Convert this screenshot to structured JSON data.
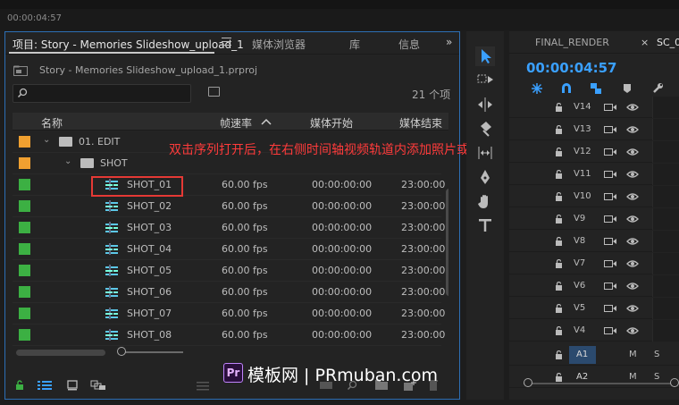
{
  "top": {
    "timecode": "00:00:04:57"
  },
  "project": {
    "tabs": [
      {
        "label": "项目: Story - Memories Slideshow_upload_1"
      },
      {
        "label": "媒体浏览器"
      },
      {
        "label": "库"
      },
      {
        "label": "信息"
      }
    ],
    "more": "»",
    "path": "Story - Memories Slideshow_upload_1.prproj",
    "count": "21 个项",
    "columns": {
      "name": "名称",
      "fps": "帧速率",
      "start": "媒体开始",
      "end": "媒体结束"
    },
    "rows": [
      {
        "name": "01. EDIT",
        "kind": "folder",
        "level": 0,
        "chip": "#f0a030",
        "fps": "",
        "start": "",
        "end": ""
      },
      {
        "name": "SHOT",
        "kind": "folder",
        "level": 1,
        "chip": "#f0a030",
        "fps": "",
        "start": "",
        "end": ""
      },
      {
        "name": "SHOT_01",
        "kind": "sequence",
        "level": 2,
        "chip": "#3cb043",
        "fps": "60.00 fps",
        "start": "00:00:00:00",
        "end": "23:00:00"
      },
      {
        "name": "SHOT_02",
        "kind": "sequence",
        "level": 2,
        "chip": "#3cb043",
        "fps": "60.00 fps",
        "start": "00:00:00:00",
        "end": "23:00:00"
      },
      {
        "name": "SHOT_03",
        "kind": "sequence",
        "level": 2,
        "chip": "#3cb043",
        "fps": "60.00 fps",
        "start": "00:00:00:00",
        "end": "23:00:00"
      },
      {
        "name": "SHOT_04",
        "kind": "sequence",
        "level": 2,
        "chip": "#3cb043",
        "fps": "60.00 fps",
        "start": "00:00:00:00",
        "end": "23:00:00"
      },
      {
        "name": "SHOT_05",
        "kind": "sequence",
        "level": 2,
        "chip": "#3cb043",
        "fps": "60.00 fps",
        "start": "00:00:00:00",
        "end": "23:00:00"
      },
      {
        "name": "SHOT_06",
        "kind": "sequence",
        "level": 2,
        "chip": "#3cb043",
        "fps": "60.00 fps",
        "start": "00:00:00:00",
        "end": "23:00:00"
      },
      {
        "name": "SHOT_07",
        "kind": "sequence",
        "level": 2,
        "chip": "#3cb043",
        "fps": "60.00 fps",
        "start": "00:00:00:00",
        "end": "23:00:00"
      },
      {
        "name": "SHOT_08",
        "kind": "sequence",
        "level": 2,
        "chip": "#3cb043",
        "fps": "60.00 fps",
        "start": "00:00:00:00",
        "end": "23:00:00"
      }
    ]
  },
  "annotation": "双击序列打开后，在右侧时间轴视频轨道内添加照片或视频",
  "watermark": {
    "logo": "Pr",
    "text": "模板网 | PRmuban.com"
  },
  "timeline": {
    "tabs": [
      {
        "label": "FINAL_RENDER"
      },
      {
        "label": "SC_0"
      }
    ],
    "close": "×",
    "timecode": "00:00:04:57",
    "video_tracks": [
      "V14",
      "V13",
      "V12",
      "V11",
      "V10",
      "V9",
      "V8",
      "V7",
      "V6",
      "V5",
      "V4"
    ],
    "audio_tracks": [
      {
        "name": "A1",
        "m": "M",
        "s": "S"
      },
      {
        "name": "A2",
        "m": "M",
        "s": "S"
      }
    ]
  },
  "colors": {
    "accent": "#2d6fb5",
    "timecode": "#3aa0ff",
    "highlight": "#e53935"
  }
}
